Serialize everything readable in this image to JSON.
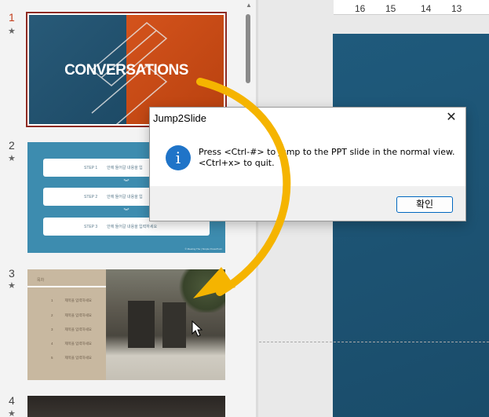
{
  "thumbnails": [
    {
      "number": "1",
      "title": "CONVERSATIONS"
    },
    {
      "number": "2",
      "steps": [
        {
          "label": "STEP 1",
          "text": "안에 들어갈 내용을 입"
        },
        {
          "label": "STEP 2",
          "text": "안에 들어갈 내용을 입"
        },
        {
          "label": "STEP 3",
          "text": "안에 들어갈 내용을 입력하세요"
        }
      ],
      "footer": "© Meeting The | Simple PowerPoint"
    },
    {
      "number": "3",
      "header": "목차",
      "rows": [
        {
          "n": "1",
          "text": "제목을 입력하세요"
        },
        {
          "n": "2",
          "text": "제목을 입력하세요"
        },
        {
          "n": "3",
          "text": "제목을 입력하세요"
        },
        {
          "n": "4",
          "text": "제목을 입력하세요"
        },
        {
          "n": "5",
          "text": "제목을 입력하세요"
        }
      ]
    },
    {
      "number": "4"
    }
  ],
  "star_glyph": "★",
  "ruler_ticks": [
    "16",
    "15",
    "14",
    "13"
  ],
  "dialog": {
    "title": "Jump2Slide",
    "close_glyph": "✕",
    "icon": "i",
    "message_line1": "Press <Ctrl-#> to jump to the PPT slide in the normal view.",
    "message_line2": "<Ctrl+x> to quit.",
    "ok_label": "확인"
  },
  "colors": {
    "active_slide_border": "#8e2a22",
    "annotation_arrow": "#f5b400",
    "info_icon": "#1f74c8"
  },
  "icons": {
    "dialog_icon": "info-icon",
    "close": "close-icon",
    "pointer": "mouse-cursor-icon"
  }
}
